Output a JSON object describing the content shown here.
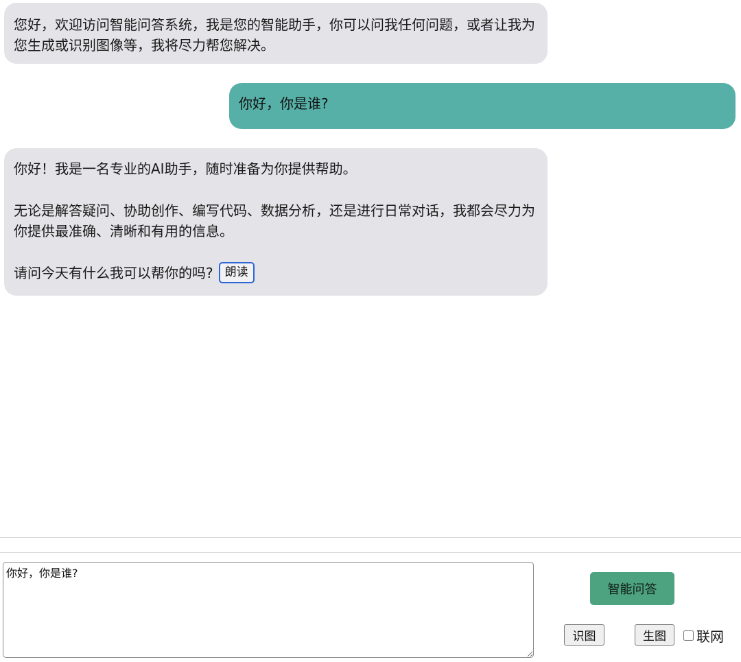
{
  "messages": [
    {
      "role": "assistant",
      "text": "您好，欢迎访问智能问答系统，我是您的智能助手，你可以问我任何问题，或者让我为您生成或识别图像等，我将尽力帮您解决。"
    },
    {
      "role": "user",
      "text": "你好，你是谁?"
    },
    {
      "role": "assistant",
      "paragraphs": [
        "你好！我是一名专业的AI助手，随时准备为你提供帮助。",
        "无论是解答疑问、协助创作、编写代码、数据分析，还是进行日常对话，我都会尽力为你提供最准确、清晰和有用的信息。",
        "请问今天有什么我可以帮你的吗?"
      ],
      "read_aloud_label": "朗读"
    }
  ],
  "composer": {
    "input_value": "你好，你是谁?",
    "qa_button_label": "智能问答",
    "recognize_image_label": "识图",
    "generate_image_label": "生图",
    "web_search_label": "联网",
    "web_search_checked": false
  },
  "colors": {
    "assistant_bubble": "#e4e4e8",
    "user_bubble": "#57b0a7",
    "primary_button": "#4da27f"
  }
}
